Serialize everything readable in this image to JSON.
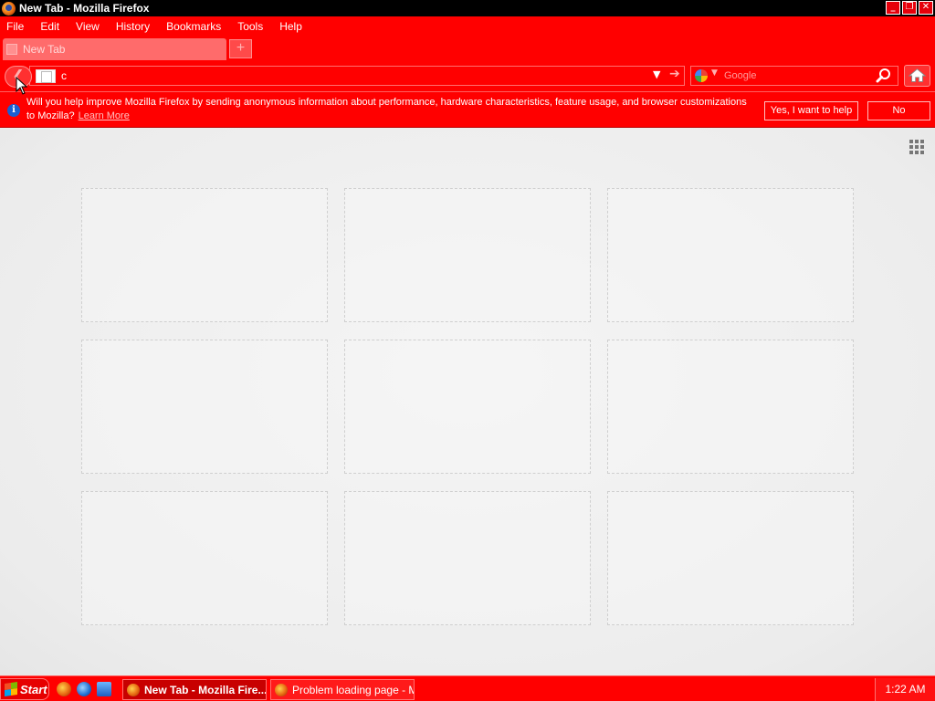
{
  "window": {
    "title": "New Tab - Mozilla Firefox",
    "controls": {
      "minimize": "_",
      "maximize": "❐",
      "close": "✕"
    }
  },
  "menubar": {
    "items": [
      {
        "label": "File"
      },
      {
        "label": "Edit"
      },
      {
        "label": "View"
      },
      {
        "label": "History"
      },
      {
        "label": "Bookmarks"
      },
      {
        "label": "Tools"
      },
      {
        "label": "Help"
      }
    ]
  },
  "tabs": [
    {
      "label": "New Tab",
      "active": true
    }
  ],
  "newtab_button": "+",
  "navbar": {
    "back_icon": "back-arrow-icon",
    "url_value": "c",
    "search_engine_icon": "google-icon",
    "search_placeholder": "Google",
    "home_icon": "home-icon"
  },
  "notification": {
    "message": "Will you help improve Mozilla Firefox by sending anonymous information about performance, hardware characteristics, feature usage, and browser customizations to Mozilla?",
    "link": "Learn More",
    "yes_label": "Yes, I want to help",
    "no_label": "No"
  },
  "newtab_page": {
    "tiles": [
      {
        "title": ""
      },
      {
        "title": ""
      },
      {
        "title": ""
      },
      {
        "title": ""
      },
      {
        "title": ""
      },
      {
        "title": ""
      },
      {
        "title": ""
      },
      {
        "title": ""
      },
      {
        "title": ""
      }
    ]
  },
  "taskbar": {
    "start_label": "Start",
    "quick_launch": [
      "firefox-icon",
      "ie-icon",
      "outlook-icon"
    ],
    "tasks": [
      {
        "label": "New Tab - Mozilla Fire...",
        "active": true
      },
      {
        "label": "Problem loading page - M...",
        "active": false
      }
    ],
    "clock": "1:22 AM"
  },
  "colors": {
    "theme_red": "#ff0000",
    "title_bar": "#000000",
    "content_bg": "#efefef"
  }
}
